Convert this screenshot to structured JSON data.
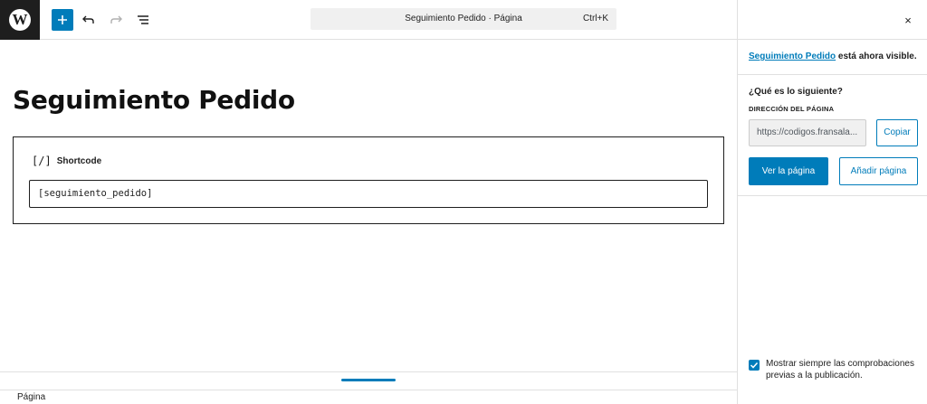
{
  "toolbar": {
    "logo_icon": "wordpress-logo",
    "logo_letter": "W",
    "inserter_icon": "plus-icon",
    "undo_icon": "undo-icon",
    "redo_icon": "redo-icon",
    "list_view_icon": "list-view-icon",
    "command_bar": {
      "title": "Seguimiento Pedido · Página",
      "shortcut": "Ctrl+K"
    },
    "accent_color": "#007cba"
  },
  "editor": {
    "page_title": "Seguimiento Pedido",
    "shortcode_block": {
      "icon_text": "[/]",
      "label": "Shortcode",
      "value": "[seguimiento_pedido]"
    }
  },
  "footer": {
    "breadcrumb": "Página"
  },
  "panel": {
    "close_icon": "×",
    "visible_link": "Seguimiento Pedido",
    "visible_suffix": " está ahora visible.",
    "next_title": "¿Qué es lo siguiente?",
    "address_label": "DIRECCIÓN DEL PÁGINA",
    "url_value": "https://codigos.fransala...",
    "copy_label": "Copiar",
    "view_label": "Ver la página",
    "add_label": "Añadir página",
    "checkbox_checked": true,
    "checkbox_label": "Mostrar siempre las comprobaciones previas a la publicación."
  }
}
